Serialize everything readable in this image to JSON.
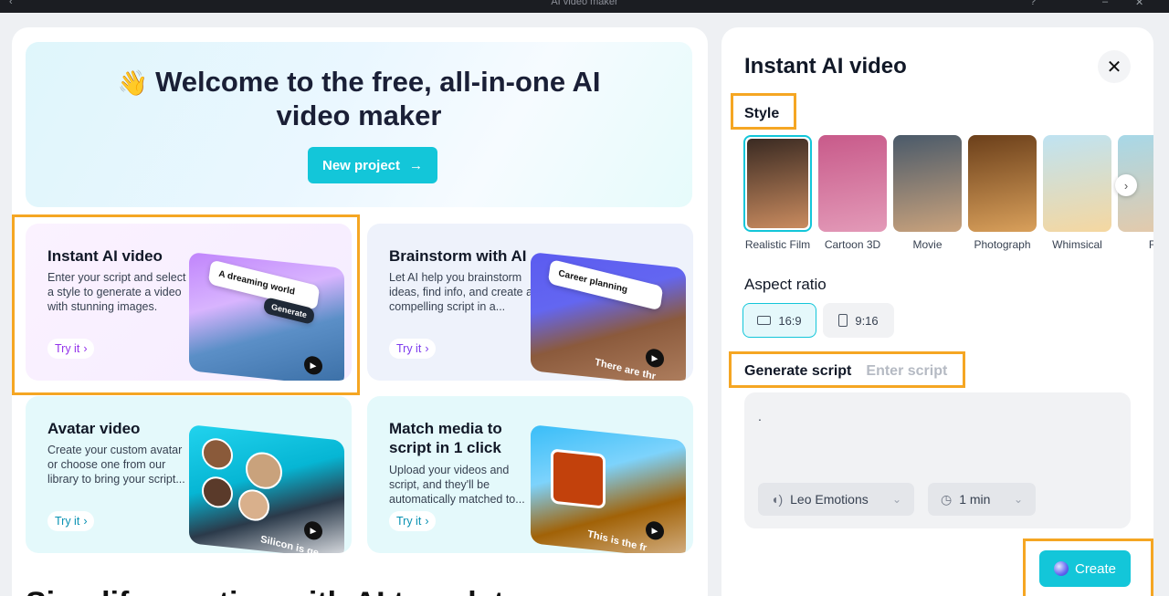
{
  "window": {
    "title": "AI video maker"
  },
  "hero": {
    "emoji": "👋",
    "title_line1": "Welcome to the free, all-in-one AI",
    "title_line2": "video maker",
    "new_project_label": "New project"
  },
  "cards": [
    {
      "title": "Instant AI video",
      "description": "Enter your script and select a style to generate a video with stunning images.",
      "try_label": "Try it",
      "pill": "A dreaming world",
      "pill_button": "Generate"
    },
    {
      "title": "Brainstorm with AI",
      "description": "Let AI help you brainstorm ideas, find info, and create a compelling script in a...",
      "try_label": "Try it",
      "pill": "Career planning",
      "overlay": "There are thr"
    },
    {
      "title": "Avatar video",
      "description": "Create your custom avatar or choose one from our library to bring your script...",
      "try_label": "Try it",
      "overlay": "Silicon is ge"
    },
    {
      "title": "Match media to script in 1 click",
      "description": "Upload your videos and script, and they'll be automatically matched to...",
      "try_label": "Try it",
      "overlay": "This is the fr"
    }
  ],
  "bottom_heading": "Simplify creation with AI templates",
  "panel": {
    "title": "Instant AI video",
    "close_icon": "close-icon",
    "style_label": "Style",
    "styles": [
      {
        "name": "Realistic Film",
        "selected": true,
        "colors": [
          "#3a2a22",
          "#c98b5f"
        ]
      },
      {
        "name": "Cartoon 3D",
        "selected": false,
        "colors": [
          "#c85a8a",
          "#e39ab8"
        ]
      },
      {
        "name": "Movie",
        "selected": false,
        "colors": [
          "#4a5a6a",
          "#c9a27c"
        ]
      },
      {
        "name": "Photograph",
        "selected": false,
        "colors": [
          "#6b3f1a",
          "#d9a05b"
        ]
      },
      {
        "name": "Whimsical",
        "selected": false,
        "colors": [
          "#bfe3f2",
          "#f5d7a0"
        ]
      },
      {
        "name": "F",
        "selected": false,
        "colors": [
          "#a7d8e8",
          "#e6c9a8"
        ]
      }
    ],
    "aspect_label": "Aspect ratio",
    "aspect_options": [
      {
        "label": "16:9",
        "selected": true
      },
      {
        "label": "9:16",
        "selected": false
      }
    ],
    "tab_active": "Generate script",
    "tab_inactive": "Enter script",
    "script_text": ".",
    "voice_label": "Leo Emotions",
    "duration_label": "1 min",
    "create_label": "Create"
  },
  "colors": {
    "accent": "#13c6d9",
    "highlight": "#f5a623"
  }
}
